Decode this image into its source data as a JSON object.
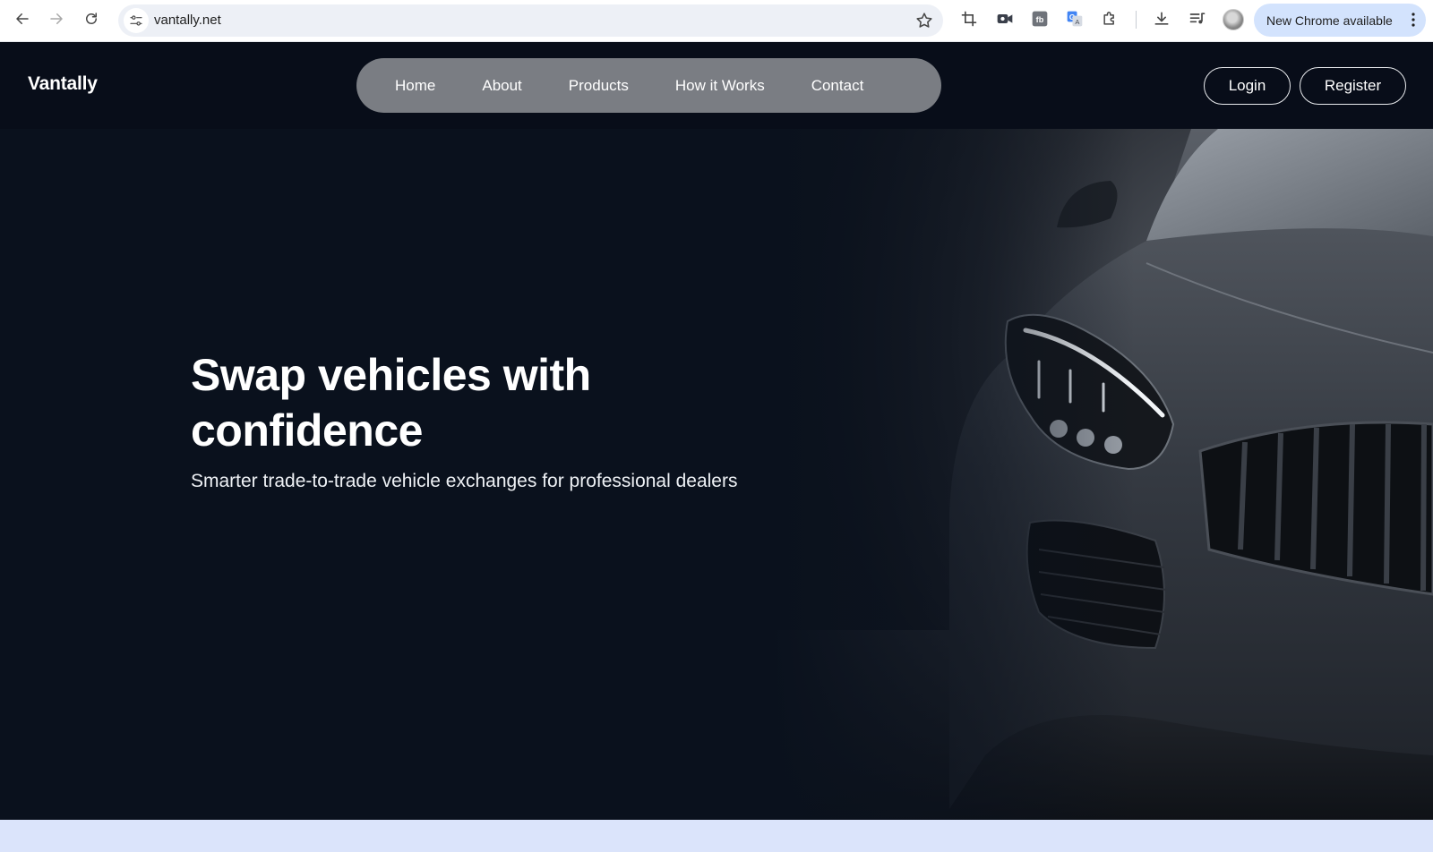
{
  "browser": {
    "url": "vantally.net",
    "update_label": "New Chrome available",
    "icons": {
      "back": "arrow-left-icon",
      "forward": "arrow-right-icon",
      "reload": "reload-icon",
      "site_info": "tune-icon",
      "bookmark": "star-icon",
      "screenshot": "crop-icon",
      "video": "video-camera-icon",
      "extension_fb": "fb-extension-icon",
      "translate": "translate-icon",
      "extensions": "puzzle-icon",
      "downloads": "download-icon",
      "media": "queue-music-icon",
      "profile": "avatar-icon",
      "menu": "kebab-menu-icon"
    }
  },
  "header": {
    "logo": "Vantally",
    "nav": [
      "Home",
      "About",
      "Products",
      "How it Works",
      "Contact"
    ],
    "login_label": "Login",
    "register_label": "Register"
  },
  "hero": {
    "title": "Swap vehicles with confidence",
    "subtitle": "Smarter trade-to-trade vehicle exchanges for professional dealers"
  },
  "colors": {
    "header_bg": "#080d19",
    "hero_bg": "#0a111d",
    "nav_pill": "#7a7d83",
    "update_pill": "#d3e3fd",
    "below_strip": "#dbe4fb"
  }
}
